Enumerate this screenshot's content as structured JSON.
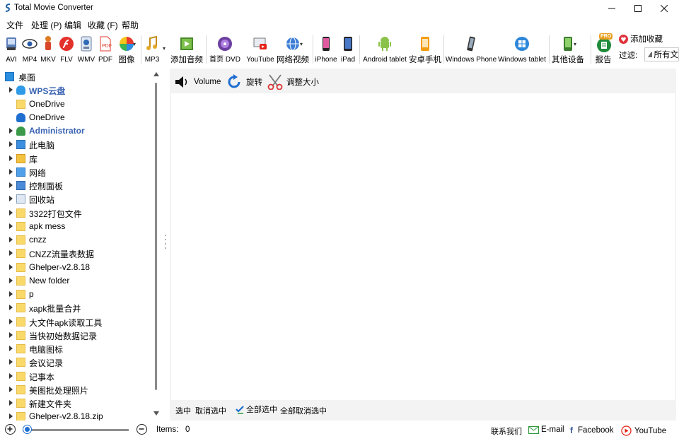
{
  "window": {
    "title": "Total Movie Converter"
  },
  "menu": [
    "文件",
    "处理 (P)",
    "编辑",
    "收藏 (F)",
    "帮助"
  ],
  "toolbar": {
    "formats": [
      {
        "label": "AVI",
        "icon": "avi-icon"
      },
      {
        "label": "MP4",
        "icon": "mp4-icon"
      },
      {
        "label": "MKV",
        "icon": "mkv-icon"
      },
      {
        "label": "FLV",
        "icon": "flv-icon"
      },
      {
        "label": "WMV",
        "icon": "wmv-icon"
      },
      {
        "label": "PDF",
        "icon": "pdf-icon"
      },
      {
        "label": "图像",
        "icon": "image-icon"
      }
    ],
    "mp3": "MP3",
    "add_audio": "添加音频",
    "dvd": "首页 DVD",
    "youtube": "YouTube",
    "web_video": "网络视频",
    "iphone": "iPhone",
    "ipad": "iPad",
    "android_tablet": "Android tablet",
    "android_phone": "安卓手机",
    "windows_phone": "Windows Phone",
    "windows_tablet": "Windows tablet",
    "other_devices": "其他设备",
    "report": "报告",
    "pro_badge": "PRO",
    "add_favorite": "添加收藏",
    "filter_label": "过滤:",
    "filter_value": "所有文"
  },
  "tree": [
    {
      "label": "桌面",
      "icon": "desktop-icon",
      "level": 0,
      "bold": false,
      "arrow": false
    },
    {
      "label": "WPS云盘",
      "icon": "cloud-icon",
      "level": 1,
      "bold": true,
      "arrow": true
    },
    {
      "label": "OneDrive",
      "icon": "folder-icon",
      "level": 1,
      "bold": false,
      "arrow": false
    },
    {
      "label": "OneDrive",
      "icon": "onedrive-icon",
      "level": 1,
      "bold": false,
      "arrow": false
    },
    {
      "label": "Administrator",
      "icon": "user-icon",
      "level": 1,
      "bold": true,
      "arrow": true
    },
    {
      "label": "此电脑",
      "icon": "computer-icon",
      "level": 1,
      "bold": false,
      "arrow": true
    },
    {
      "label": "库",
      "icon": "library-icon",
      "level": 1,
      "bold": false,
      "arrow": true
    },
    {
      "label": "网络",
      "icon": "network-icon",
      "level": 1,
      "bold": false,
      "arrow": true
    },
    {
      "label": "控制面板",
      "icon": "control-panel-icon",
      "level": 1,
      "bold": false,
      "arrow": true
    },
    {
      "label": "回收站",
      "icon": "recycle-bin-icon",
      "level": 1,
      "bold": false,
      "arrow": true
    },
    {
      "label": "3322打包文件",
      "icon": "folder-icon",
      "level": 1,
      "bold": false,
      "arrow": true
    },
    {
      "label": "apk mess",
      "icon": "folder-icon",
      "level": 1,
      "bold": false,
      "arrow": true
    },
    {
      "label": "cnzz",
      "icon": "folder-icon",
      "level": 1,
      "bold": false,
      "arrow": true
    },
    {
      "label": "CNZZ流量表数据",
      "icon": "folder-icon",
      "level": 1,
      "bold": false,
      "arrow": true
    },
    {
      "label": "Ghelper-v2.8.18",
      "icon": "folder-icon",
      "level": 1,
      "bold": false,
      "arrow": true
    },
    {
      "label": "New folder",
      "icon": "folder-icon",
      "level": 1,
      "bold": false,
      "arrow": true
    },
    {
      "label": "p",
      "icon": "folder-icon",
      "level": 1,
      "bold": false,
      "arrow": true
    },
    {
      "label": "xapk批量合并",
      "icon": "folder-icon",
      "level": 1,
      "bold": false,
      "arrow": true
    },
    {
      "label": "大文件apk读取工具",
      "icon": "folder-icon",
      "level": 1,
      "bold": false,
      "arrow": true
    },
    {
      "label": "当快初始数据记录",
      "icon": "folder-icon",
      "level": 1,
      "bold": false,
      "arrow": true
    },
    {
      "label": "电脑图标",
      "icon": "folder-icon",
      "level": 1,
      "bold": false,
      "arrow": true
    },
    {
      "label": "会议记录",
      "icon": "folder-icon",
      "level": 1,
      "bold": false,
      "arrow": true
    },
    {
      "label": "记事本",
      "icon": "folder-icon",
      "level": 1,
      "bold": false,
      "arrow": true
    },
    {
      "label": "美图批处理照片",
      "icon": "folder-icon",
      "level": 1,
      "bold": false,
      "arrow": true
    },
    {
      "label": "新建文件夹",
      "icon": "folder-icon",
      "level": 1,
      "bold": false,
      "arrow": true
    },
    {
      "label": "Ghelper-v2.8.18.zip",
      "icon": "folder-icon",
      "level": 1,
      "bold": false,
      "arrow": true
    }
  ],
  "edit_tools": {
    "volume": "Volume",
    "rotate": "旋转",
    "resize": "调整大小"
  },
  "selection": {
    "select": "选中",
    "deselect": "取消选中",
    "select_all": "全部选中",
    "deselect_all": "全部取消选中"
  },
  "status": {
    "items_label": "Items:",
    "items_count": "0",
    "contact": "联系我们",
    "email": "E-mail",
    "facebook": "Facebook",
    "youtube": "YouTube"
  }
}
